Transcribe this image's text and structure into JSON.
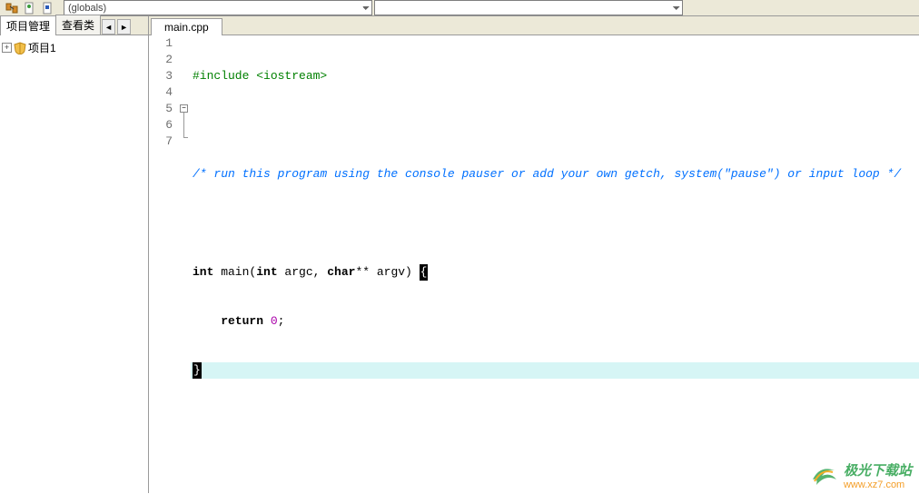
{
  "toolbar": {
    "combo_scope": "(globals)",
    "combo_func": ""
  },
  "sidebar": {
    "tabs": {
      "project": "项目管理",
      "classview": "查看类"
    },
    "nav": {
      "prev": "◄",
      "next": "►"
    },
    "tree": {
      "root_label": "项目1"
    }
  },
  "editor": {
    "tab": "main.cpp",
    "lines": [
      {
        "n": "1",
        "pre": "#include",
        "rest": " <iostream>"
      },
      {
        "n": "2"
      },
      {
        "n": "3",
        "cmt": "/* run this program using the console pauser or add your own getch, system(\"pause\") or input loop */"
      },
      {
        "n": "4"
      },
      {
        "n": "5",
        "kw1": "int",
        "t1": " main(",
        "kw2": "int",
        "t2": " argc, ",
        "kw3": "char",
        "t3": "** argv) ",
        "brace_open": "{"
      },
      {
        "n": "6",
        "indent": "    ",
        "kw_ret": "return",
        "sp": " ",
        "zero": "0",
        "semi": ";"
      },
      {
        "n": "7",
        "brace_close": "}"
      }
    ]
  },
  "watermark": {
    "cn": "极光下载站",
    "url": "www.xz7.com"
  }
}
